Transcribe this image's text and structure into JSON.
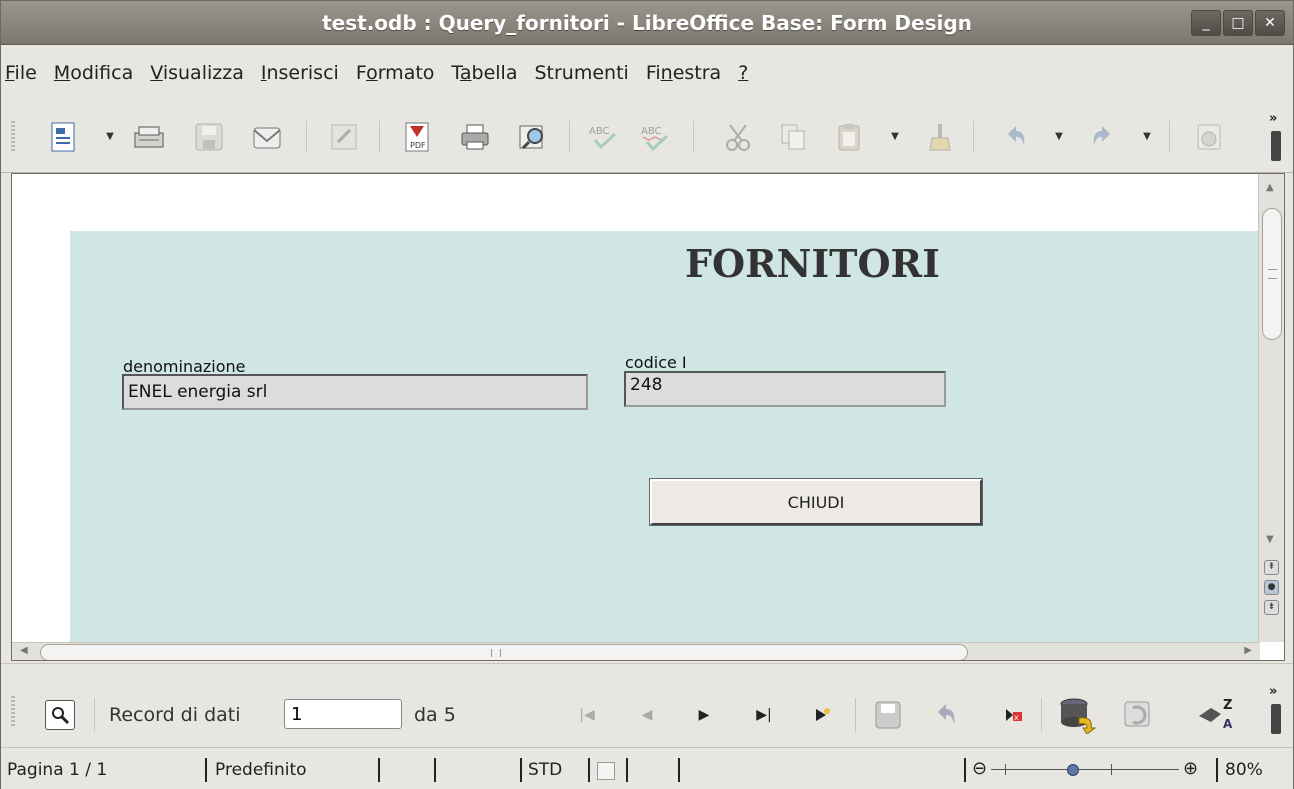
{
  "window": {
    "title": "test.odb : Query_fornitori - LibreOffice Base: Form Design",
    "minimize": "_",
    "maximize": "□",
    "close": "✕"
  },
  "menu": [
    {
      "pre": "",
      "u": "F",
      "post": "ile"
    },
    {
      "pre": "",
      "u": "M",
      "post": "odifica"
    },
    {
      "pre": "",
      "u": "V",
      "post": "isualizza"
    },
    {
      "pre": "",
      "u": "I",
      "post": "nserisci"
    },
    {
      "pre": "F",
      "u": "o",
      "post": "rmato"
    },
    {
      "pre": "T",
      "u": "a",
      "post": "bella"
    },
    {
      "pre": "Strumenti",
      "u": "",
      "post": ""
    },
    {
      "pre": "Fi",
      "u": "n",
      "post": "estra"
    },
    {
      "pre": "",
      "u": "?",
      "post": ""
    }
  ],
  "toolbar": {
    "icons": [
      "new-icon",
      "open-icon",
      "save-icon",
      "email-icon",
      "edit-icon",
      "pdf-icon",
      "print-icon",
      "preview-icon",
      "spellcheck-icon",
      "autospell-icon",
      "cut-icon",
      "copy-icon",
      "paste-icon",
      "format-paintbrush-icon",
      "undo-icon",
      "redo-icon",
      "navigator-icon"
    ],
    "more": "»"
  },
  "form": {
    "title": "FORNITORI",
    "fields": {
      "denominazione_label": "denominazione",
      "denominazione_value": "ENEL energia srl",
      "codice_label": "codice I",
      "codice_value": "248"
    },
    "close_button": "CHIUDI"
  },
  "navigation": {
    "record_label": "Record di dati",
    "record_value": "1",
    "total_label": "da 5",
    "more": "»",
    "sort_label": "Z\nA"
  },
  "status": {
    "page": "Pagina 1 / 1",
    "style": "Predefinito",
    "mode": "STD",
    "zoom": "80%",
    "zoom_minus": "⊖",
    "zoom_plus": "⊕"
  },
  "colors": {
    "form_background": "#d0e6e4",
    "field_background": "#dcdcdc",
    "titlebar": "#8a867d"
  }
}
